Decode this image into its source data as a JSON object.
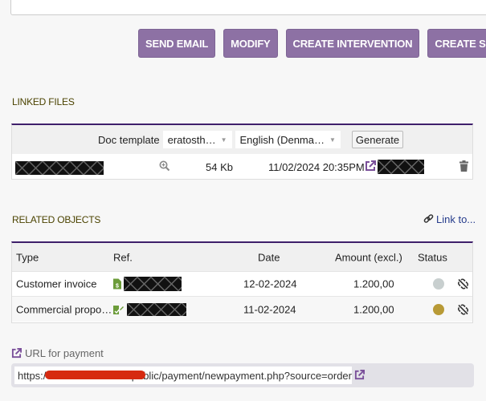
{
  "actions": {
    "send_email": "SEND EMAIL",
    "modify": "MODIFY",
    "create_intervention": "CREATE INTERVENTION",
    "create_shipment": "CREATE SHIPMENT"
  },
  "linked_files": {
    "title": "LINKED FILES",
    "doc_template_label": "Doc template",
    "template_select": "eratosth…",
    "language_select": "English (Denma…",
    "generate_label": "Generate",
    "files": [
      {
        "name": "[redacted]",
        "size": "54 Kb",
        "date": "11/02/2024 20:35PM",
        "link": "[redacted]"
      }
    ]
  },
  "related_objects": {
    "title": "RELATED OBJECTS",
    "link_to_label": "Link to...",
    "columns": [
      "Type",
      "Ref.",
      "Date",
      "Amount (excl.)",
      "Status"
    ],
    "rows": [
      {
        "type": "Customer invoice",
        "ref": "[redacted]",
        "date": "12-02-2024",
        "amount": "1.200,00",
        "status_color": "#c8cfcf",
        "icon": "invoice-icon"
      },
      {
        "type": "Commercial propo…",
        "ref": "[redacted]",
        "date": "11-02-2024",
        "amount": "1.200,00",
        "status_color": "#b89a36",
        "icon": "proposal-icon"
      }
    ]
  },
  "payment": {
    "label": "URL for payment",
    "url_prefix": "https:/",
    "url_suffix": "/public/payment/newpayment.php?source=order"
  },
  "colors": {
    "button": "#8d71a4",
    "panel_border": "#3f1f6b",
    "link": "#263c8c",
    "section_title": "#4b4300",
    "icon_green": "#6c9c3a",
    "icon_purple": "#7a4f9a"
  }
}
